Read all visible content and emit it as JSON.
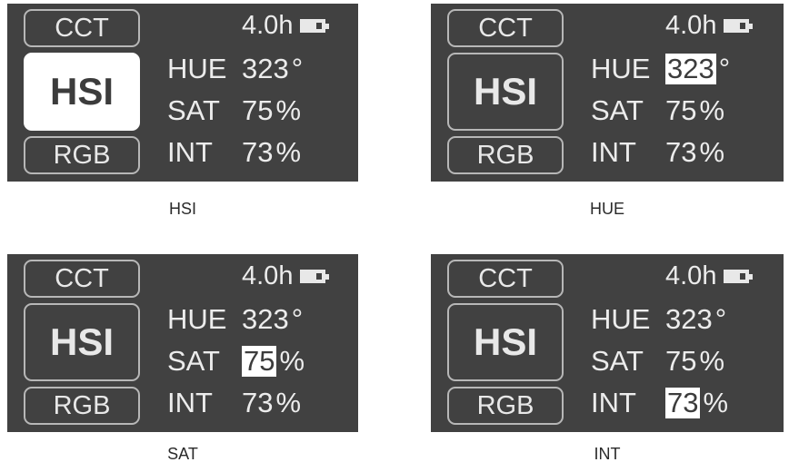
{
  "panels": [
    {
      "mode_buttons": {
        "cct": "CCT",
        "hsi": "HSI",
        "rgb": "RGB"
      },
      "active_mode": "HSI",
      "runtime": "4.0h",
      "battery_level": 0.7,
      "hue": {
        "label": "HUE",
        "value": "323",
        "unit": "°"
      },
      "sat": {
        "label": "SAT",
        "value": "75",
        "unit": "%"
      },
      "int": {
        "label": "INT",
        "value": "73",
        "unit": "%"
      },
      "highlighted": "mode",
      "caption": "HSI"
    },
    {
      "mode_buttons": {
        "cct": "CCT",
        "hsi": "HSI",
        "rgb": "RGB"
      },
      "runtime": "4.0h",
      "battery_level": 0.7,
      "hue": {
        "label": "HUE",
        "value": "323",
        "unit": "°"
      },
      "sat": {
        "label": "SAT",
        "value": "75",
        "unit": "%"
      },
      "int": {
        "label": "INT",
        "value": "73",
        "unit": "%"
      },
      "highlighted": "hue",
      "caption": "HUE"
    },
    {
      "mode_buttons": {
        "cct": "CCT",
        "hsi": "HSI",
        "rgb": "RGB"
      },
      "runtime": "4.0h",
      "battery_level": 0.7,
      "hue": {
        "label": "HUE",
        "value": "323",
        "unit": "°"
      },
      "sat": {
        "label": "SAT",
        "value": "75",
        "unit": "%"
      },
      "int": {
        "label": "INT",
        "value": "73",
        "unit": "%"
      },
      "highlighted": "sat",
      "caption": "SAT"
    },
    {
      "mode_buttons": {
        "cct": "CCT",
        "hsi": "HSI",
        "rgb": "RGB"
      },
      "runtime": "4.0h",
      "battery_level": 0.7,
      "hue": {
        "label": "HUE",
        "value": "323",
        "unit": "°"
      },
      "sat": {
        "label": "SAT",
        "value": "75",
        "unit": "%"
      },
      "int": {
        "label": "INT",
        "value": "73",
        "unit": "%"
      },
      "highlighted": "int",
      "caption": "INT"
    }
  ],
  "colors": {
    "screen_background": "#414141",
    "text": "#ececec",
    "highlight": "#ffffff"
  },
  "icons": {
    "battery": "battery-icon"
  }
}
